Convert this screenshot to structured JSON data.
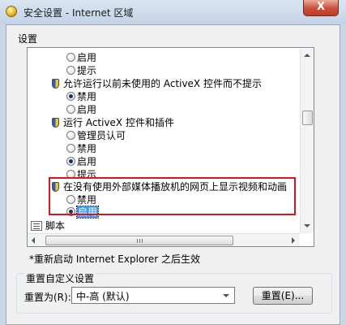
{
  "window": {
    "title": "安全设置 - Internet 区域",
    "close_label": "X"
  },
  "settings": {
    "label": "设置",
    "items": [
      {
        "type": "radio",
        "text": "启用",
        "checked": false
      },
      {
        "type": "radio",
        "text": "提示",
        "checked": false
      },
      {
        "type": "heading",
        "icon": "shield-icon",
        "text": "允许运行以前未使用的 ActiveX 控件而不提示"
      },
      {
        "type": "radio",
        "text": "禁用",
        "checked": true
      },
      {
        "type": "radio",
        "text": "启用",
        "checked": false
      },
      {
        "type": "heading",
        "icon": "shield-icon",
        "text": "运行 ActiveX 控件和插件"
      },
      {
        "type": "radio",
        "text": "管理员认可",
        "checked": false
      },
      {
        "type": "radio",
        "text": "禁用",
        "checked": false
      },
      {
        "type": "radio",
        "text": "启用",
        "checked": true
      },
      {
        "type": "radio",
        "text": "提示",
        "checked": false
      },
      {
        "type": "heading",
        "icon": "shield-icon",
        "text": "在没有使用外部媒体播放机的网页上显示视频和动画"
      },
      {
        "type": "radio",
        "text": "禁用",
        "checked": false
      },
      {
        "type": "radio",
        "text": "启用",
        "checked": true,
        "selected": true
      },
      {
        "type": "category",
        "icon": "script-icon",
        "text": "脚本"
      }
    ]
  },
  "restart_note": "*重新启动 Internet Explorer 之后生效",
  "reset": {
    "group_title": "重置自定义设置",
    "reset_to_label": "重置为(R):",
    "level_value": "中-高 (默认)",
    "reset_button": "重置(E)..."
  },
  "colors": {
    "highlight": "#e0121b",
    "selection": "#3399ff"
  }
}
